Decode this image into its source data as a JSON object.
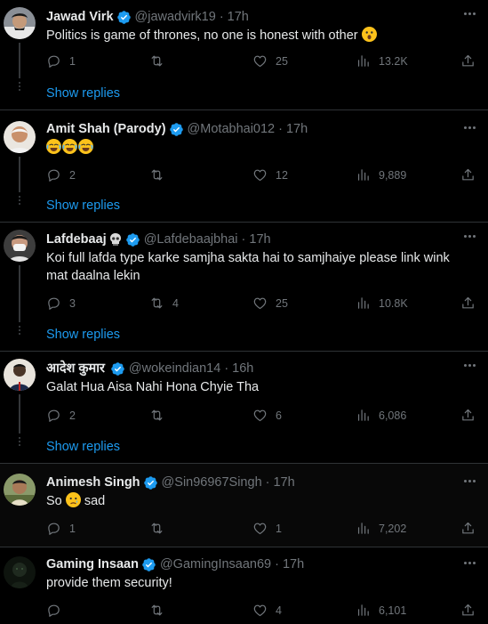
{
  "tweets": [
    {
      "name": "Jawad Virk",
      "handle": "@jawadvirk19",
      "time": "17h",
      "text": "Politics is game of thrones, no one is honest with other",
      "reply_count": "1",
      "retweet_count": "",
      "like_count": "25",
      "view_count": "13.2K",
      "show_replies": "Show replies"
    },
    {
      "name": "Amit Shah (Parody)",
      "handle": "@Motabhai012",
      "time": "17h",
      "text": "",
      "reply_count": "2",
      "retweet_count": "",
      "like_count": "12",
      "view_count": "9,889",
      "show_replies": "Show replies"
    },
    {
      "name": "Lafdebaaj",
      "handle": "@Lafdebaajbhai",
      "time": "17h",
      "text": "Koi full lafda type karke samjha sakta hai to samjhaiye please link wink mat daalna lekin",
      "reply_count": "3",
      "retweet_count": "4",
      "like_count": "25",
      "view_count": "10.8K",
      "show_replies": "Show replies"
    },
    {
      "name": "आदेश कुमार",
      "handle": "@wokeindian14",
      "time": "16h",
      "text": "Galat Hua Aisa Nahi Hona Chyie Tha",
      "reply_count": "2",
      "retweet_count": "",
      "like_count": "6",
      "view_count": "6,086",
      "show_replies": "Show replies"
    },
    {
      "name": "Animesh Singh",
      "handle": "@Sin96967Singh",
      "time": "17h",
      "text_before": "So",
      "text_after": "sad",
      "reply_count": "1",
      "retweet_count": "",
      "like_count": "1",
      "view_count": "7,202"
    },
    {
      "name": "Gaming Insaan",
      "handle": "@GamingInsaan69",
      "time": "17h",
      "text": "provide them security!",
      "reply_count": "",
      "retweet_count": "",
      "like_count": "4",
      "view_count": "6,101"
    }
  ],
  "colors": {
    "background": "#000000",
    "text": "#e7e9ea",
    "muted": "#71767b",
    "link": "#1d9bf0",
    "verified": "#1d9bf0",
    "divider": "#2f3336"
  },
  "icons": [
    "verified-badge-icon",
    "more-icon",
    "reply-icon",
    "retweet-icon",
    "like-icon",
    "views-icon",
    "share-icon",
    "skull-emoji",
    "joy-emoji",
    "surprised-emoji",
    "crying-emoji"
  ]
}
